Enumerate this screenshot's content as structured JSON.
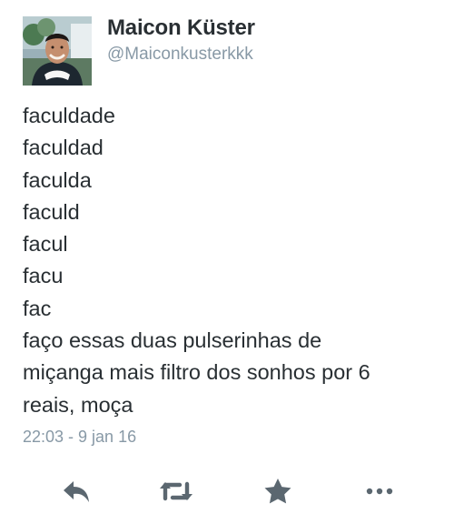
{
  "author": {
    "name": "Maicon Küster",
    "handle": "@Maiconkusterkkk",
    "avatar_icon": "profile-photo-icon"
  },
  "tweet": {
    "lines": [
      "faculdade",
      "faculdad",
      "faculda",
      "faculd",
      "facul",
      "facu",
      "fac",
      "faço essas duas pulserinhas de",
      "miçanga mais filtro dos sonhos por 6",
      "reais, moça"
    ],
    "timestamp": "22:03 - 9 jan 16"
  },
  "actions": {
    "reply": "reply-icon",
    "retweet": "retweet-icon",
    "favorite": "star-icon",
    "more": "more-icon"
  },
  "colors": {
    "text": "#292f33",
    "muted": "#8899a6",
    "icon": "#5b6770",
    "background": "#ffffff"
  }
}
